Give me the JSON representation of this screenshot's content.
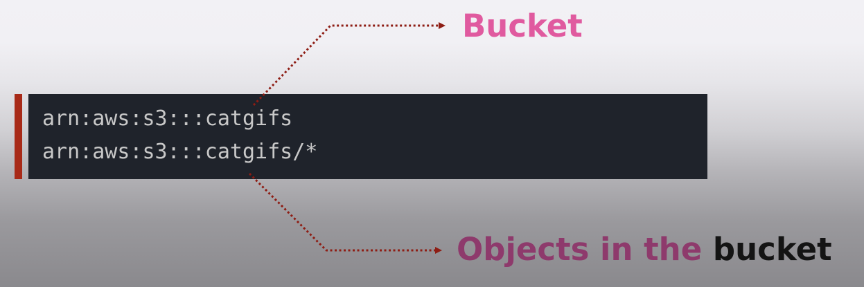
{
  "code": {
    "lines": [
      "arn:aws:s3:::catgifs",
      "arn:aws:s3:::catgifs/*"
    ]
  },
  "labels": {
    "bucket": "Bucket",
    "objects_prefix": "Objects in the",
    "objects_suffix": "bucket"
  },
  "colors": {
    "accent_bar": "#a82a18",
    "code_background": "#1f232b",
    "code_text": "#c8c8c8",
    "connector": "#8e1d14",
    "bucket_label": "#e05a9f",
    "objects_prefix": "#8e3a6c",
    "objects_suffix": "#141414"
  }
}
